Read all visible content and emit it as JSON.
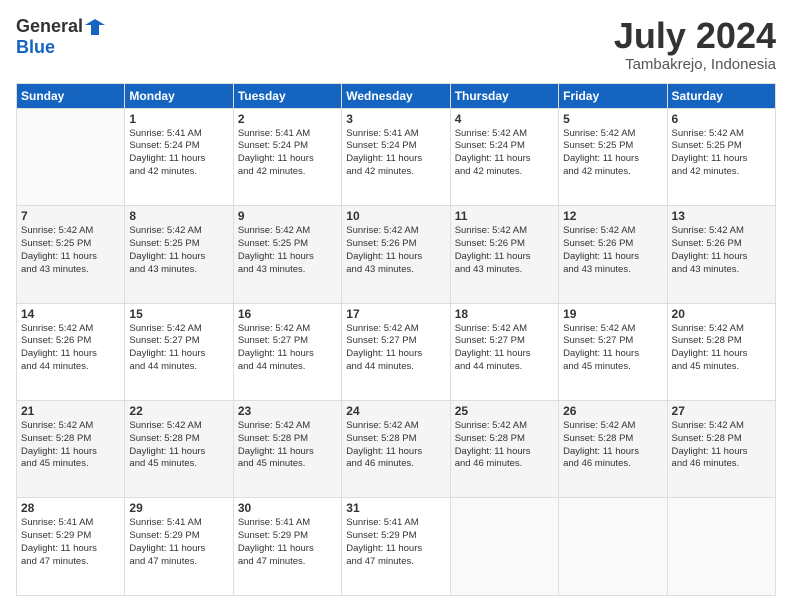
{
  "header": {
    "logo_general": "General",
    "logo_blue": "Blue",
    "month_title": "July 2024",
    "location": "Tambakrejo, Indonesia"
  },
  "weekdays": [
    "Sunday",
    "Monday",
    "Tuesday",
    "Wednesday",
    "Thursday",
    "Friday",
    "Saturday"
  ],
  "weeks": [
    [
      {
        "day": "",
        "info": ""
      },
      {
        "day": "1",
        "info": "Sunrise: 5:41 AM\nSunset: 5:24 PM\nDaylight: 11 hours\nand 42 minutes."
      },
      {
        "day": "2",
        "info": "Sunrise: 5:41 AM\nSunset: 5:24 PM\nDaylight: 11 hours\nand 42 minutes."
      },
      {
        "day": "3",
        "info": "Sunrise: 5:41 AM\nSunset: 5:24 PM\nDaylight: 11 hours\nand 42 minutes."
      },
      {
        "day": "4",
        "info": "Sunrise: 5:42 AM\nSunset: 5:24 PM\nDaylight: 11 hours\nand 42 minutes."
      },
      {
        "day": "5",
        "info": "Sunrise: 5:42 AM\nSunset: 5:25 PM\nDaylight: 11 hours\nand 42 minutes."
      },
      {
        "day": "6",
        "info": "Sunrise: 5:42 AM\nSunset: 5:25 PM\nDaylight: 11 hours\nand 42 minutes."
      }
    ],
    [
      {
        "day": "7",
        "info": "Sunrise: 5:42 AM\nSunset: 5:25 PM\nDaylight: 11 hours\nand 43 minutes."
      },
      {
        "day": "8",
        "info": "Sunrise: 5:42 AM\nSunset: 5:25 PM\nDaylight: 11 hours\nand 43 minutes."
      },
      {
        "day": "9",
        "info": "Sunrise: 5:42 AM\nSunset: 5:25 PM\nDaylight: 11 hours\nand 43 minutes."
      },
      {
        "day": "10",
        "info": "Sunrise: 5:42 AM\nSunset: 5:26 PM\nDaylight: 11 hours\nand 43 minutes."
      },
      {
        "day": "11",
        "info": "Sunrise: 5:42 AM\nSunset: 5:26 PM\nDaylight: 11 hours\nand 43 minutes."
      },
      {
        "day": "12",
        "info": "Sunrise: 5:42 AM\nSunset: 5:26 PM\nDaylight: 11 hours\nand 43 minutes."
      },
      {
        "day": "13",
        "info": "Sunrise: 5:42 AM\nSunset: 5:26 PM\nDaylight: 11 hours\nand 43 minutes."
      }
    ],
    [
      {
        "day": "14",
        "info": "Sunrise: 5:42 AM\nSunset: 5:26 PM\nDaylight: 11 hours\nand 44 minutes."
      },
      {
        "day": "15",
        "info": "Sunrise: 5:42 AM\nSunset: 5:27 PM\nDaylight: 11 hours\nand 44 minutes."
      },
      {
        "day": "16",
        "info": "Sunrise: 5:42 AM\nSunset: 5:27 PM\nDaylight: 11 hours\nand 44 minutes."
      },
      {
        "day": "17",
        "info": "Sunrise: 5:42 AM\nSunset: 5:27 PM\nDaylight: 11 hours\nand 44 minutes."
      },
      {
        "day": "18",
        "info": "Sunrise: 5:42 AM\nSunset: 5:27 PM\nDaylight: 11 hours\nand 44 minutes."
      },
      {
        "day": "19",
        "info": "Sunrise: 5:42 AM\nSunset: 5:27 PM\nDaylight: 11 hours\nand 45 minutes."
      },
      {
        "day": "20",
        "info": "Sunrise: 5:42 AM\nSunset: 5:28 PM\nDaylight: 11 hours\nand 45 minutes."
      }
    ],
    [
      {
        "day": "21",
        "info": "Sunrise: 5:42 AM\nSunset: 5:28 PM\nDaylight: 11 hours\nand 45 minutes."
      },
      {
        "day": "22",
        "info": "Sunrise: 5:42 AM\nSunset: 5:28 PM\nDaylight: 11 hours\nand 45 minutes."
      },
      {
        "day": "23",
        "info": "Sunrise: 5:42 AM\nSunset: 5:28 PM\nDaylight: 11 hours\nand 45 minutes."
      },
      {
        "day": "24",
        "info": "Sunrise: 5:42 AM\nSunset: 5:28 PM\nDaylight: 11 hours\nand 46 minutes."
      },
      {
        "day": "25",
        "info": "Sunrise: 5:42 AM\nSunset: 5:28 PM\nDaylight: 11 hours\nand 46 minutes."
      },
      {
        "day": "26",
        "info": "Sunrise: 5:42 AM\nSunset: 5:28 PM\nDaylight: 11 hours\nand 46 minutes."
      },
      {
        "day": "27",
        "info": "Sunrise: 5:42 AM\nSunset: 5:28 PM\nDaylight: 11 hours\nand 46 minutes."
      }
    ],
    [
      {
        "day": "28",
        "info": "Sunrise: 5:41 AM\nSunset: 5:29 PM\nDaylight: 11 hours\nand 47 minutes."
      },
      {
        "day": "29",
        "info": "Sunrise: 5:41 AM\nSunset: 5:29 PM\nDaylight: 11 hours\nand 47 minutes."
      },
      {
        "day": "30",
        "info": "Sunrise: 5:41 AM\nSunset: 5:29 PM\nDaylight: 11 hours\nand 47 minutes."
      },
      {
        "day": "31",
        "info": "Sunrise: 5:41 AM\nSunset: 5:29 PM\nDaylight: 11 hours\nand 47 minutes."
      },
      {
        "day": "",
        "info": ""
      },
      {
        "day": "",
        "info": ""
      },
      {
        "day": "",
        "info": ""
      }
    ]
  ]
}
